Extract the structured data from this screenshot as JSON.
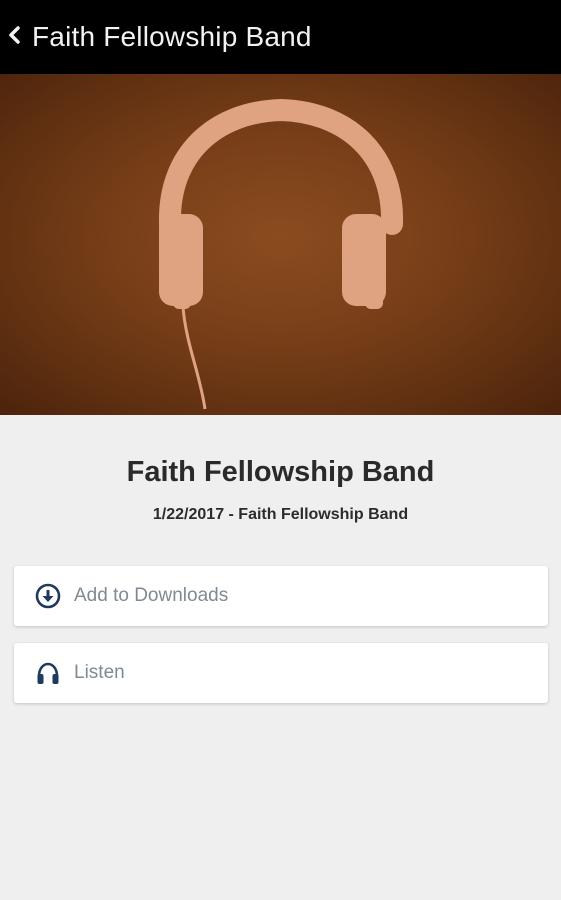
{
  "header": {
    "title": "Faith Fellowship Band",
    "back_icon": "chevron-left-icon"
  },
  "hero": {
    "icon": "headphones-icon",
    "background_color": "#7a3f18",
    "artwork_color": "#e0a382"
  },
  "episode": {
    "title": "Faith Fellowship Band",
    "subtitle": "1/22/2017 - Faith Fellowship Band"
  },
  "actions": [
    {
      "label": "Add to Downloads",
      "icon": "download-circle-icon"
    },
    {
      "label": "Listen",
      "icon": "headphones-icon"
    }
  ],
  "colors": {
    "topbar": "#000000",
    "icon_accent": "#1f3a5c",
    "action_text": "#7f8a94",
    "page_background": "#efefef"
  }
}
